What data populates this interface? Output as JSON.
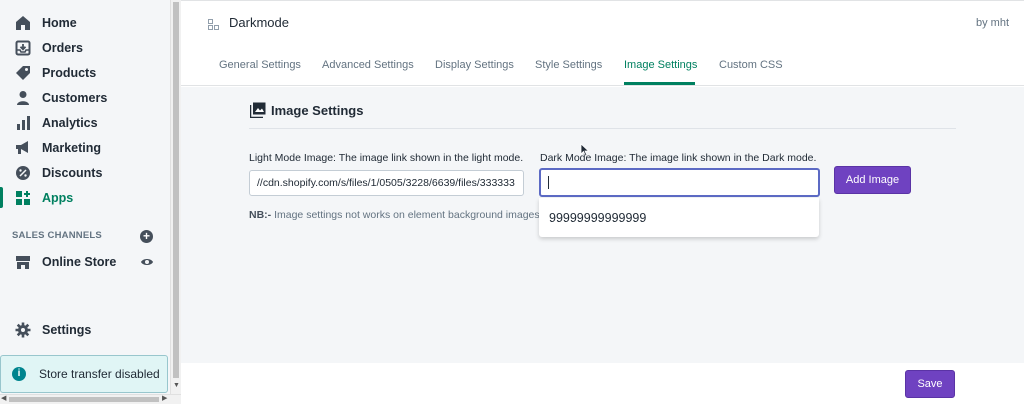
{
  "sidebar": {
    "items": [
      {
        "label": "Home",
        "icon": "home-icon"
      },
      {
        "label": "Orders",
        "icon": "orders-icon"
      },
      {
        "label": "Products",
        "icon": "tag-icon"
      },
      {
        "label": "Customers",
        "icon": "person-icon"
      },
      {
        "label": "Analytics",
        "icon": "bar-chart-icon"
      },
      {
        "label": "Marketing",
        "icon": "megaphone-icon"
      },
      {
        "label": "Discounts",
        "icon": "discount-icon"
      },
      {
        "label": "Apps",
        "icon": "apps-icon"
      }
    ],
    "sales_channels_label": "SALES CHANNELS",
    "online_store_label": "Online Store",
    "settings_label": "Settings",
    "toast_text": "Store transfer disabled"
  },
  "header": {
    "app_title": "Darkmode",
    "by": "by mht"
  },
  "tabs": [
    {
      "label": "General Settings"
    },
    {
      "label": "Advanced Settings"
    },
    {
      "label": "Display Settings"
    },
    {
      "label": "Style Settings"
    },
    {
      "label": "Image Settings"
    },
    {
      "label": "Custom CSS"
    }
  ],
  "active_tab": "Image Settings",
  "panel": {
    "title": "Image Settings",
    "light_label": "Light Mode Image: The image link shown in the light mode.",
    "light_value": "//cdn.shopify.com/s/files/1/0505/3228/6639/files/333333",
    "dark_label": "Dark Mode Image: The image link shown in the Dark mode.",
    "dark_value": "",
    "add_button": "Add Image",
    "nb_prefix": "NB:-",
    "nb_text": " Image settings not works on element background images",
    "suggestion": "99999999999999"
  },
  "footer": {
    "save_button": "Save"
  },
  "colors": {
    "accent": "#008060",
    "button": "#6f42c1",
    "focus_border": "#5c6ac4"
  }
}
